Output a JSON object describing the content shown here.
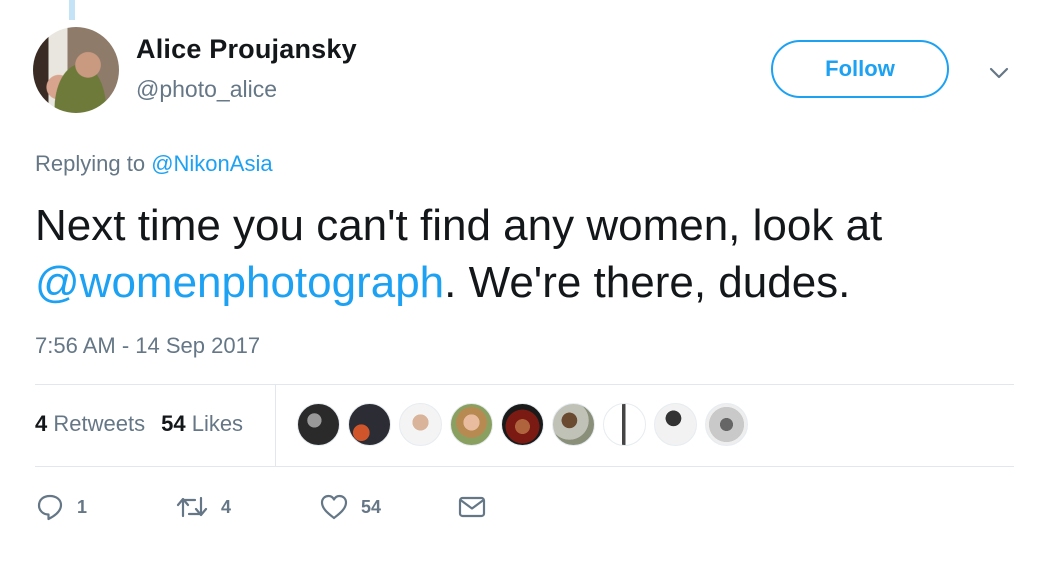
{
  "author": {
    "name": "Alice Proujansky",
    "handle": "@photo_alice"
  },
  "follow_label": "Follow",
  "replying": {
    "prefix": "Replying to ",
    "mention": "@NikonAsia"
  },
  "tweet": {
    "text_part1": "Next time you can't find any women, look at",
    "mention": "@womenphotograph",
    "text_part2": ". We're there, dudes."
  },
  "timestamp": "7:56 AM - 14 Sep 2017",
  "stats": {
    "retweets_count": "4",
    "retweets_label": "Retweets",
    "likes_count": "54",
    "likes_label": "Likes"
  },
  "actions": {
    "reply_count": "1",
    "retweet_count": "4",
    "like_count": "54"
  },
  "colors": {
    "accent": "#1da1f2",
    "secondary_text": "#657786",
    "border": "#e1e8ed"
  },
  "icons": [
    "chevron-down-icon",
    "reply-icon",
    "retweet-icon",
    "heart-icon",
    "envelope-icon"
  ]
}
